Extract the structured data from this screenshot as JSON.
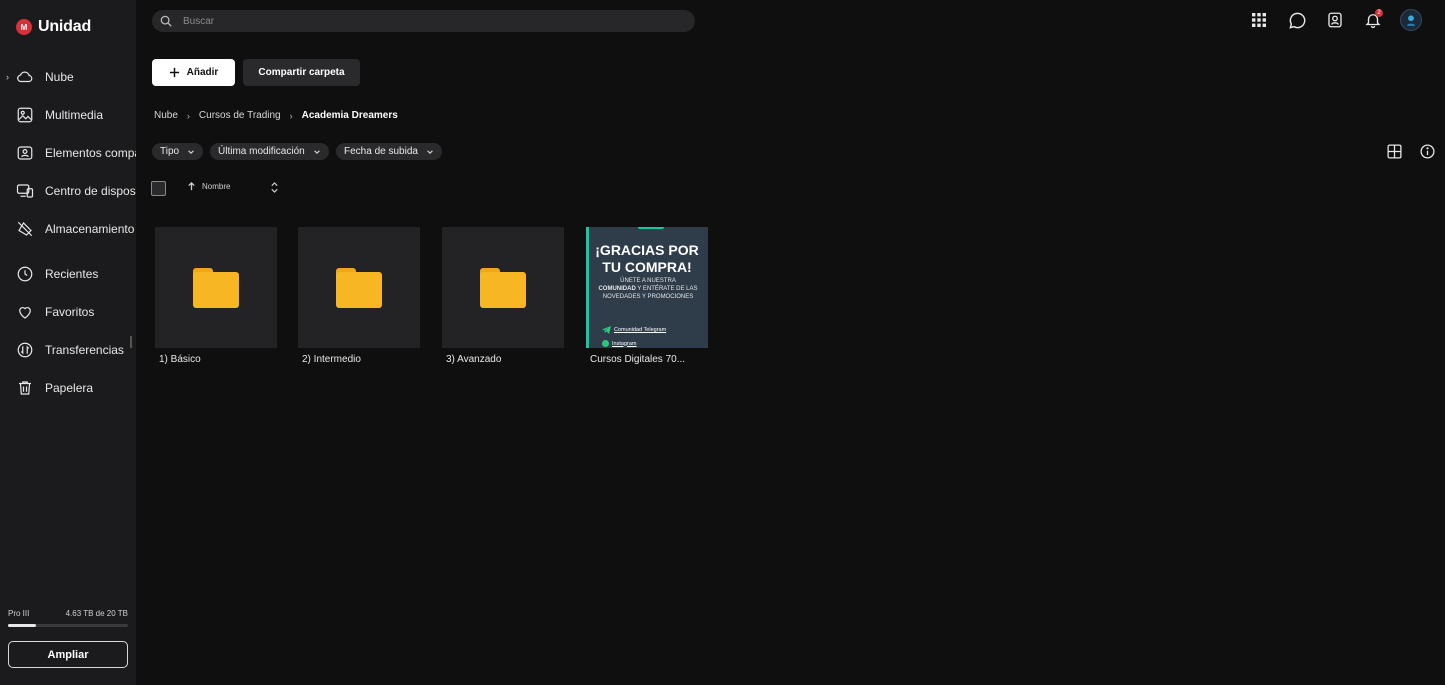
{
  "app": {
    "logo_badge": "M",
    "logo_text": "Unidad"
  },
  "search": {
    "placeholder": "Buscar"
  },
  "sidebar": {
    "items": [
      {
        "label": "Nube",
        "icon": "cloud-icon"
      },
      {
        "label": "Multimedia",
        "icon": "image-icon"
      },
      {
        "label": "Elementos compartidos",
        "icon": "shared-items-icon"
      },
      {
        "label": "Centro de dispositivos",
        "icon": "devices-icon"
      },
      {
        "label": "Almacenamiento",
        "icon": "storage-icon"
      },
      {
        "label": "Recientes",
        "icon": "clock-icon"
      },
      {
        "label": "Favoritos",
        "icon": "heart-icon"
      },
      {
        "label": "Transferencias",
        "icon": "transfer-icon"
      },
      {
        "label": "Papelera",
        "icon": "trash-icon"
      }
    ],
    "plan": "Pro III",
    "usage": "4.63 TB de 20 TB",
    "usage_fraction": 0.2315,
    "upgrade_label": "Ampliar"
  },
  "topbar": {
    "notification_count": "2"
  },
  "actions": {
    "add_label": "Añadir",
    "share_label": "Compartir carpeta"
  },
  "breadcrumb": {
    "items": [
      "Nube",
      "Cursos de Trading"
    ],
    "current": "Academia Dreamers"
  },
  "filters": {
    "type": "Tipo",
    "modified": "Última modificación",
    "uploaded": "Fecha de subida"
  },
  "sort": {
    "label": "Nombre"
  },
  "files": [
    {
      "name": "1) Básico",
      "kind": "folder"
    },
    {
      "name": "2) Intermedio",
      "kind": "folder"
    },
    {
      "name": "3) Avanzado",
      "kind": "folder"
    },
    {
      "name": "Cursos Digitales 70...",
      "kind": "image"
    }
  ],
  "promo": {
    "title": "¡GRACIAS POR TU COMPRA!",
    "text_pre": "ÚNETE A NUESTRA",
    "text_bold": "COMUNIDAD",
    "text_post": "Y ENTÉRATE DE LAS NOVEDADES Y PROMOCIONES",
    "link1": "Comunidad Telegram",
    "link2": "Instagram"
  },
  "colors": {
    "background": "#0f0f0f",
    "sidebar": "#1b1b1d",
    "accent_red": "#d7303b",
    "folder_yellow": "#f7b623"
  }
}
